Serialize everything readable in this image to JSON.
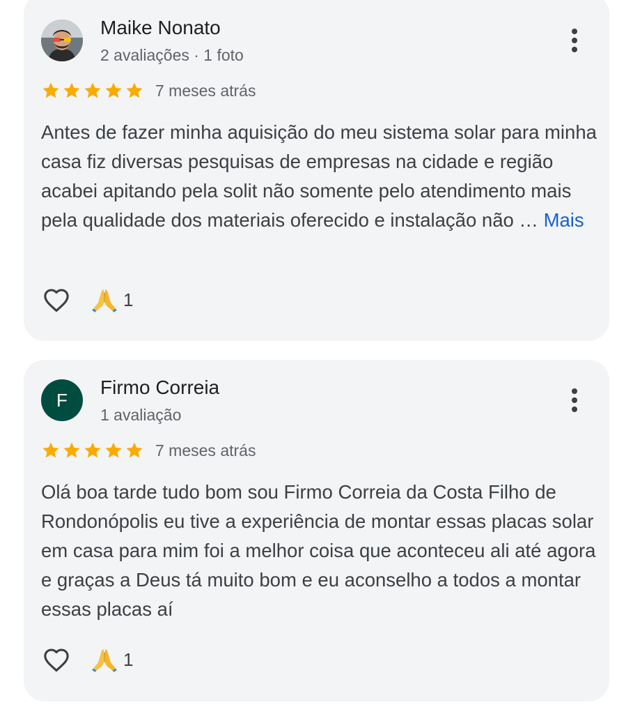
{
  "reviews": [
    {
      "author": "Maike Nonato",
      "meta": "2 avaliações · 1 foto",
      "rating": 5,
      "time": "7 meses atrás",
      "text": "Antes de fazer minha aquisição do meu sistema solar para minha casa fiz diversas pesquisas de empresas na cidade e região acabei apitando pela solit não somente pelo atendimento mais pela qualidade dos materiais oferecido e instalação não …",
      "more_label": "Mais",
      "reaction_icon": "folded-hands-icon",
      "reaction_count": "1"
    },
    {
      "author": "Firmo Correia",
      "avatar_letter": "F",
      "meta": "1 avaliação",
      "rating": 5,
      "time": "7 meses atrás",
      "text": "Olá boa tarde tudo bom sou Firmo Correia da Costa Filho de Rondonópolis eu tive a experiência de montar essas placas solar em casa para mim foi a melhor coisa que aconteceu ali até agora e graças a Deus tá muito bom e eu aconselho a todos a montar essas placas aí",
      "reaction_icon": "folded-hands-icon",
      "reaction_count": "1"
    }
  ],
  "colors": {
    "card_bg": "#f3f4f6",
    "star": "#f9ab00",
    "link": "#1a5fd0",
    "avatar_letter_bg": "#004d40"
  }
}
